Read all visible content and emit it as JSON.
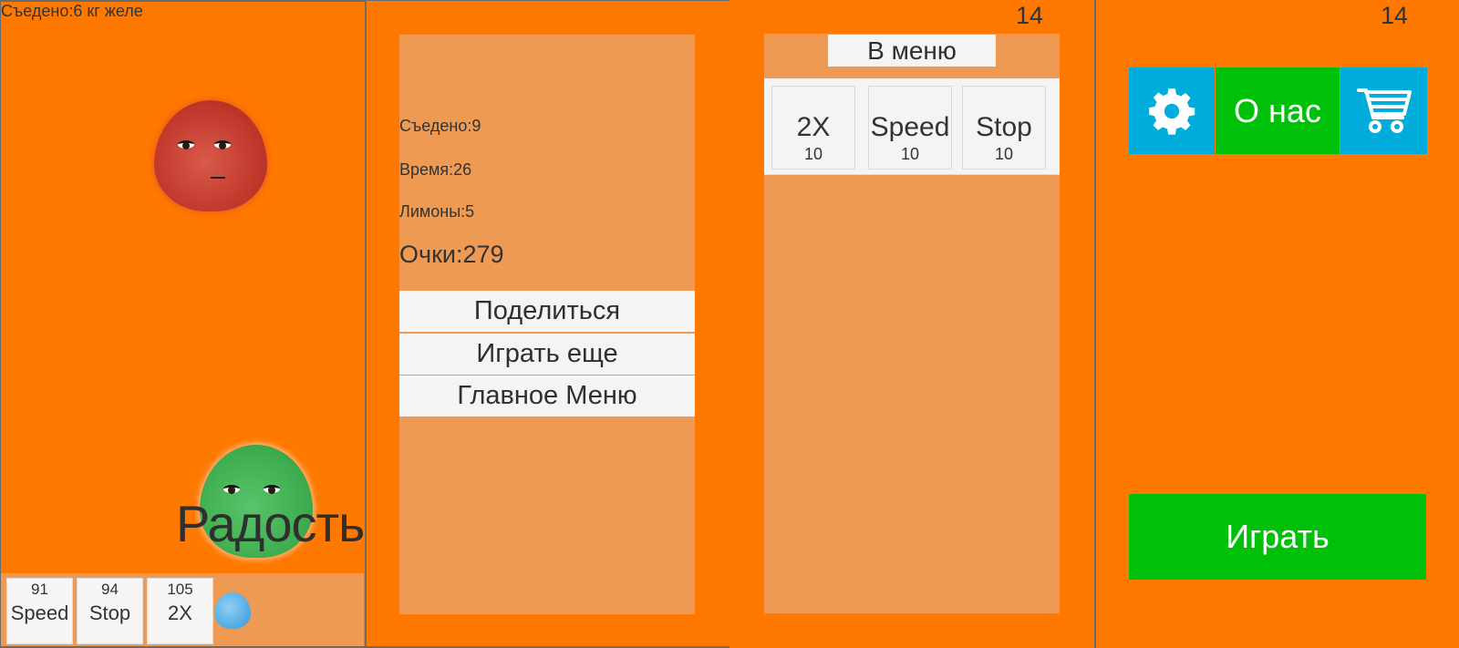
{
  "game_screen": {
    "eaten_label": "Съедено:6 кг желе",
    "emotion_label": "Радость",
    "bonuses": [
      {
        "count": "91",
        "name": "Speed"
      },
      {
        "count": "94",
        "name": "Stop"
      },
      {
        "count": "105",
        "name": "2X"
      }
    ],
    "jellies": [
      "red-jelly",
      "green-jelly",
      "blue-jelly"
    ]
  },
  "results_screen": {
    "stats": {
      "eaten": "Съедено:9",
      "time": "Время:26",
      "lemons": "Лимоны:5",
      "score": "Очки:279"
    },
    "buttons": {
      "share": "Поделиться",
      "play_again": "Играть еще",
      "main_menu": "Главное Меню"
    }
  },
  "shop_screen": {
    "coins": "14",
    "back_button": "В меню",
    "items": [
      {
        "name": "2X",
        "price": "10"
      },
      {
        "name": "Speed",
        "price": "10"
      },
      {
        "name": "Stop",
        "price": "10"
      }
    ]
  },
  "menu_screen": {
    "coins": "14",
    "settings_icon": "gear-icon",
    "about_button": "О нас",
    "cart_icon": "shopping-cart-icon",
    "play_button": "Играть"
  },
  "colors": {
    "background": "#ff7800",
    "panel": "#ee9a52",
    "button_light": "#f4f4f4",
    "tile_blue": "#00acdc",
    "tile_green": "#00c00a"
  }
}
